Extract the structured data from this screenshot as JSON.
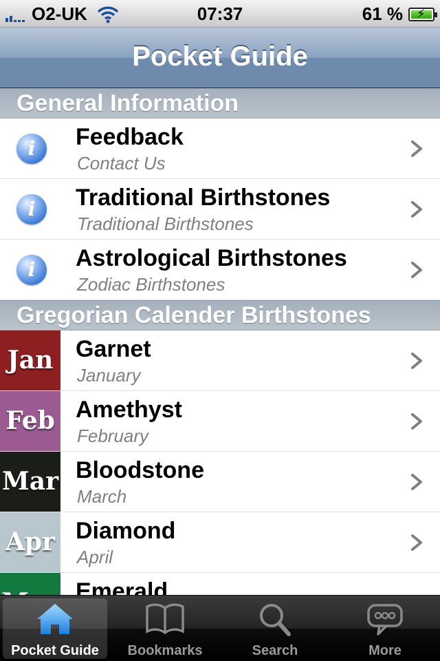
{
  "status": {
    "carrier": "O2-UK",
    "time": "07:37",
    "battery_percent": "61 %"
  },
  "nav": {
    "title": "Pocket Guide"
  },
  "sections": [
    {
      "header": "General Information"
    },
    {
      "header": "Gregorian Calender Birthstones"
    }
  ],
  "general_rows": [
    {
      "title": "Feedback",
      "subtitle": "Contact Us"
    },
    {
      "title": "Traditional Birthstones",
      "subtitle": "Traditional Birthstones"
    },
    {
      "title": "Astrological Birthstones",
      "subtitle": "Zodiac Birthstones"
    }
  ],
  "month_rows": [
    {
      "thumb": "Jan",
      "title": "Garnet",
      "subtitle": "January",
      "color": "#8e1f21"
    },
    {
      "thumb": "Feb",
      "title": "Amethyst",
      "subtitle": "February",
      "color": "#9c5a93"
    },
    {
      "thumb": "Mar",
      "title": "Bloodstone",
      "subtitle": "March",
      "color": "#1a1d18"
    },
    {
      "thumb": "Apr",
      "title": "Diamond",
      "subtitle": "April",
      "color": "#b7c7cd"
    },
    {
      "thumb": "May",
      "title": "Emerald",
      "subtitle": "",
      "color": "#127a3e"
    }
  ],
  "tabs": [
    {
      "label": "Pocket Guide",
      "icon": "home-icon"
    },
    {
      "label": "Bookmarks",
      "icon": "book-icon"
    },
    {
      "label": "Search",
      "icon": "magnifier-icon"
    },
    {
      "label": "More",
      "icon": "more-icon"
    }
  ]
}
